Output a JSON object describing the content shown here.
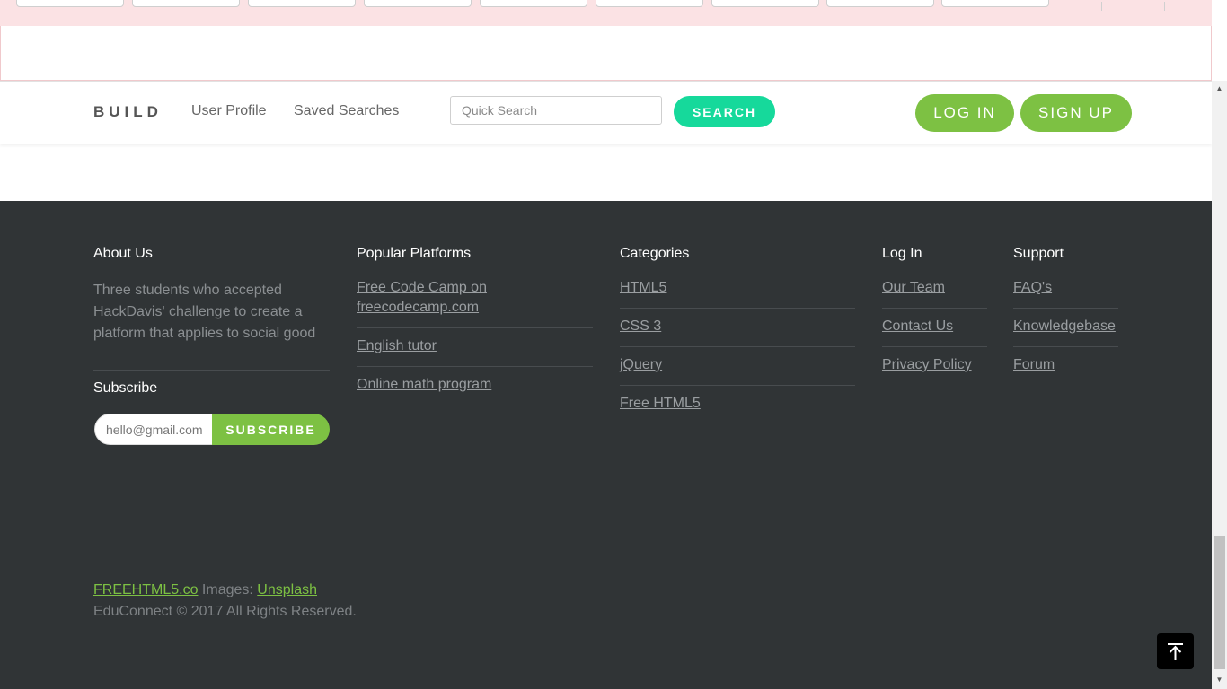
{
  "nav": {
    "brand": "BUILD",
    "links": [
      "User Profile",
      "Saved Searches"
    ],
    "search_placeholder": "Quick Search",
    "search_label": "SEARCH",
    "login_label": "LOG IN",
    "signup_label": "SIGN UP"
  },
  "footer": {
    "about": {
      "title": "About Us",
      "text": "Three students who accepted HackDavis' challenge to create a platform that applies to social good"
    },
    "subscribe": {
      "title": "Subscribe",
      "placeholder": "hello@gmail.com",
      "button": "SUBSCRIBE"
    },
    "platforms": {
      "title": "Popular Platforms",
      "links": [
        "Free Code Camp on freecodecamp.com",
        "English tutor",
        "Online math program"
      ]
    },
    "categories": {
      "title": "Categories",
      "links": [
        "HTML5",
        "CSS 3",
        "jQuery",
        "Free HTML5"
      ]
    },
    "login": {
      "title": "Log In",
      "links": [
        "Our Team",
        "Contact Us",
        "Privacy Policy"
      ]
    },
    "support": {
      "title": "Support",
      "links": [
        "FAQ's",
        "Knowledgebase",
        "Forum"
      ]
    },
    "credit_link": "FREEHTML5.co",
    "credit_images": "Images:",
    "credit_unsplash": "Unsplash",
    "copyright": "EduConnect © 2017 All Rights Reserved."
  },
  "colors": {
    "accent_green": "#7dc143",
    "search_teal": "#16d99b",
    "footer_bg": "#303436"
  },
  "icons": [
    "arrow-to-top-icon",
    "scroll-up-icon",
    "scroll-down-icon"
  ]
}
